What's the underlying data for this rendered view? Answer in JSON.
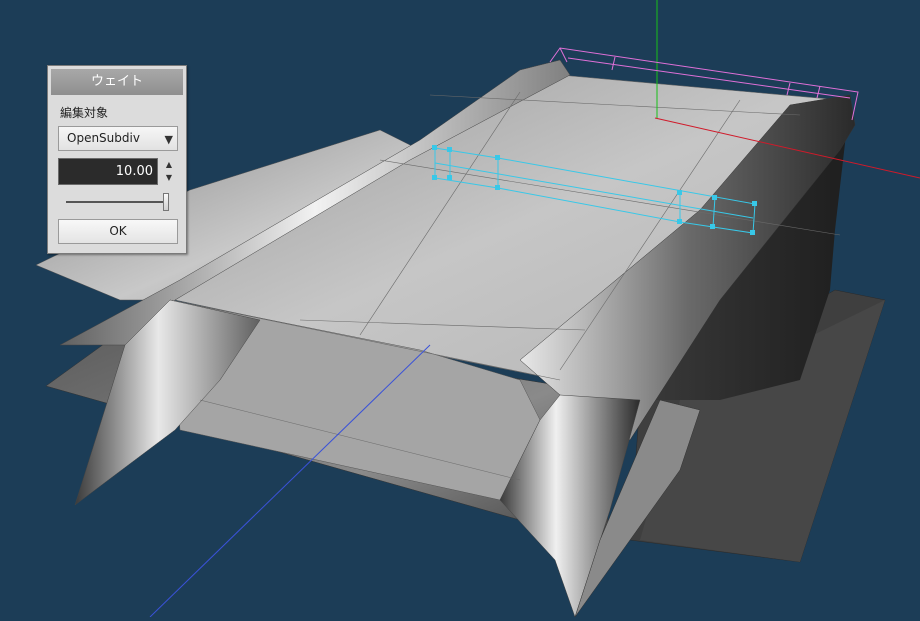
{
  "dialog": {
    "title": "ウェイト",
    "edit_target_label": "編集対象",
    "edit_target_value": "OpenSubdiv",
    "weight_value": "10.00",
    "weight_slider_fraction": 1.0,
    "ok_label": "OK"
  },
  "colors": {
    "background": "#1c3d57",
    "axis_x": "#d01a2a",
    "axis_y": "#18c018",
    "axis_z": "#3a52d8",
    "bbox": "#e070d8",
    "selection": "#38c8e8"
  },
  "icons": {
    "dropdown": "triangle-down-icon",
    "spin_up": "triangle-up-icon",
    "spin_down": "triangle-down-icon"
  }
}
